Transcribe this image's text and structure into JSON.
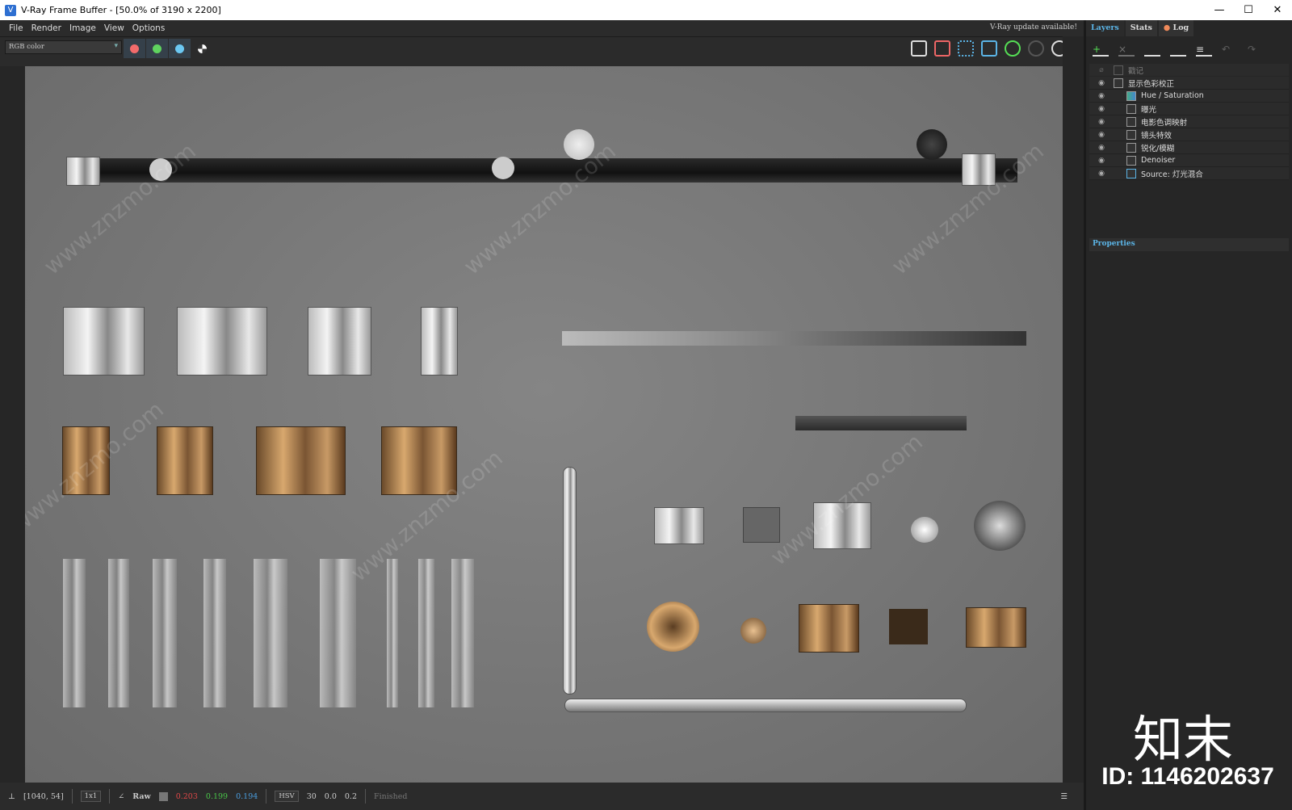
{
  "window": {
    "title": "V-Ray Frame Buffer - [50.0% of 3190 x 2200]",
    "minimize": "—",
    "maximize": "☐",
    "close": "✕"
  },
  "menu": [
    "File",
    "Render",
    "Image",
    "View",
    "Options"
  ],
  "update_notice": "V-Ray update available!",
  "toolbar": {
    "channel": "RGB color",
    "channel_colors": {
      "red": "#f26b6b",
      "green": "#5fd35f",
      "blue": "#6cc8f2"
    }
  },
  "panel": {
    "tabs": [
      "Layers",
      "Stats",
      "Log"
    ],
    "layers": [
      {
        "label": "戳记",
        "enabled": false,
        "indent": 0
      },
      {
        "label": "显示色彩校正",
        "enabled": true,
        "indent": 0
      },
      {
        "label": "Hue / Saturation",
        "enabled": true,
        "indent": 1
      },
      {
        "label": "曝光",
        "enabled": true,
        "indent": 1
      },
      {
        "label": "电影色调映射",
        "enabled": true,
        "indent": 1
      },
      {
        "label": "镜头特效",
        "enabled": true,
        "indent": 1
      },
      {
        "label": "锐化/模糊",
        "enabled": true,
        "indent": 1
      },
      {
        "label": "Denoiser",
        "enabled": true,
        "indent": 1
      },
      {
        "label": "Source: 灯光混合",
        "enabled": true,
        "indent": 1
      }
    ],
    "properties_label": "Properties"
  },
  "status": {
    "coords": "[1040, 54]",
    "zoom": "1x1",
    "mode": "Raw",
    "r": "0.203",
    "g": "0.199",
    "b": "0.194",
    "colorspace": "HSV",
    "h": "30",
    "s": "0.0",
    "v": "0.2",
    "state": "Finished"
  },
  "watermark": {
    "site": "www.znzmo.com",
    "brand": "知末",
    "id": "ID: 1146202637"
  }
}
